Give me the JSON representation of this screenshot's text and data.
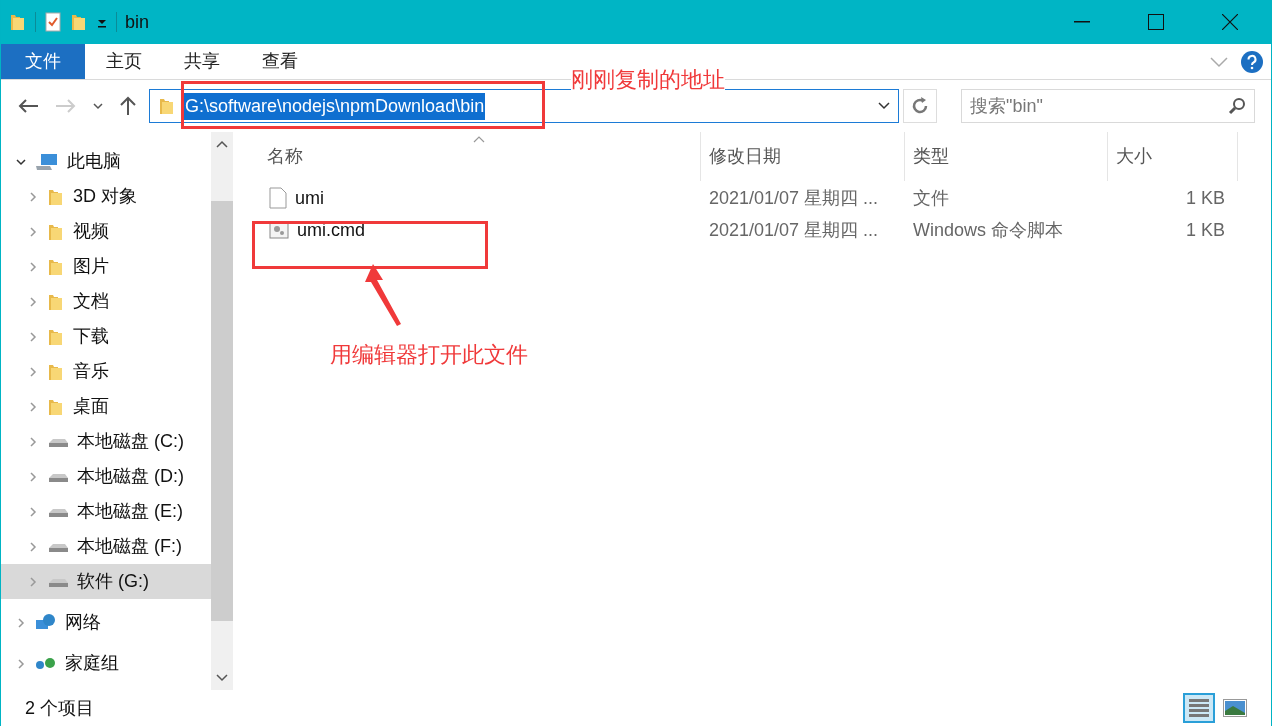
{
  "window": {
    "title": "bin"
  },
  "ribbon_tabs": [
    {
      "label": "文件",
      "selected": true
    },
    {
      "label": "主页",
      "selected": false
    },
    {
      "label": "共享",
      "selected": false
    },
    {
      "label": "查看",
      "selected": false
    }
  ],
  "address_bar": {
    "value": "G:\\software\\nodejs\\npmDownload\\bin",
    "selected": true
  },
  "search": {
    "placeholder": "搜索\"bin\""
  },
  "sidebar": {
    "items": [
      {
        "label": "此电脑",
        "kind": "computer",
        "expanded": true,
        "selected": false,
        "children": [
          {
            "label": "3D 对象",
            "kind": "folder",
            "selected": false
          },
          {
            "label": "视频",
            "kind": "folder",
            "selected": false
          },
          {
            "label": "图片",
            "kind": "folder",
            "selected": false
          },
          {
            "label": "文档",
            "kind": "folder",
            "selected": false
          },
          {
            "label": "下载",
            "kind": "folder",
            "selected": false
          },
          {
            "label": "音乐",
            "kind": "folder",
            "selected": false
          },
          {
            "label": "桌面",
            "kind": "folder",
            "selected": false
          },
          {
            "label": "本地磁盘 (C:)",
            "kind": "drive",
            "selected": false
          },
          {
            "label": "本地磁盘 (D:)",
            "kind": "drive",
            "selected": false
          },
          {
            "label": "本地磁盘 (E:)",
            "kind": "drive",
            "selected": false
          },
          {
            "label": "本地磁盘 (F:)",
            "kind": "drive",
            "selected": false
          },
          {
            "label": "软件 (G:)",
            "kind": "drive",
            "selected": true
          }
        ]
      },
      {
        "label": "网络",
        "kind": "network",
        "expanded": false,
        "selected": false
      },
      {
        "label": "家庭组",
        "kind": "homegroup",
        "expanded": false,
        "selected": false
      }
    ]
  },
  "table": {
    "columns": [
      "名称",
      "修改日期",
      "类型",
      "大小"
    ],
    "rows": [
      {
        "name": "umi",
        "kind": "file",
        "modified": "2021/01/07 星期四 ...",
        "type": "文件",
        "size": "1 KB"
      },
      {
        "name": "umi.cmd",
        "kind": "script",
        "modified": "2021/01/07 星期四 ...",
        "type": "Windows 命令脚本",
        "size": "1 KB"
      }
    ]
  },
  "annotations": [
    {
      "text": "刚刚复制的地址"
    },
    {
      "text": "用编辑器打开此文件"
    }
  ],
  "status_bar": {
    "count": "2 个项目"
  }
}
